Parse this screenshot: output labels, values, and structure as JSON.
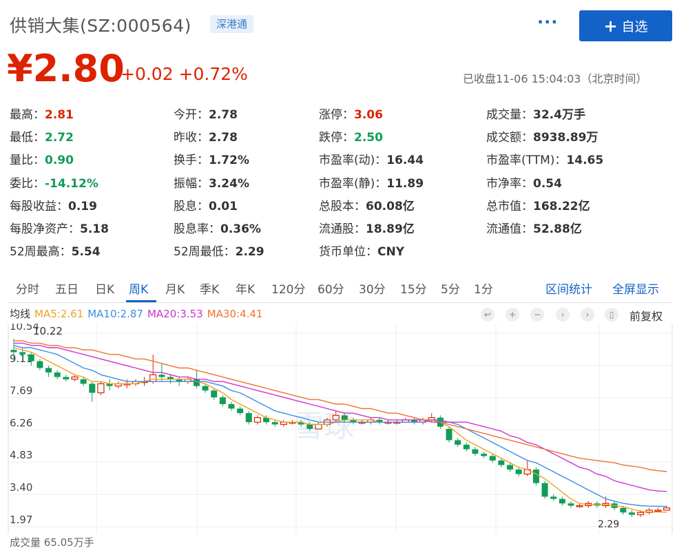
{
  "header": {
    "title": "供销大集(SZ:000564)",
    "badge": "深港通",
    "more": "···",
    "add_label": "自选",
    "add_plus": "+",
    "price": "¥2.80",
    "change": "+0.02 +0.72%",
    "status": "已收盘11-06 15:04:03（北京时间）"
  },
  "colors": {
    "up": "#dd2200",
    "down": "#109d58",
    "accent": "#1262c7"
  },
  "quote": [
    {
      "label": "最高：",
      "value": "2.81",
      "tone": "up"
    },
    {
      "label": "今开：",
      "value": "2.78",
      "tone": ""
    },
    {
      "label": "涨停：",
      "value": "3.06",
      "tone": "up"
    },
    {
      "label": "成交量：",
      "value": "32.4万手",
      "tone": ""
    },
    {
      "label": "最低：",
      "value": "2.72",
      "tone": "dn"
    },
    {
      "label": "昨收：",
      "value": "2.78",
      "tone": ""
    },
    {
      "label": "跌停：",
      "value": "2.50",
      "tone": "dn"
    },
    {
      "label": "成交额：",
      "value": "8938.89万",
      "tone": ""
    },
    {
      "label": "量比：",
      "value": "0.90",
      "tone": "dn"
    },
    {
      "label": "换手：",
      "value": "1.72%",
      "tone": ""
    },
    {
      "label": "市盈率(动)：",
      "value": "16.44",
      "tone": ""
    },
    {
      "label": "市盈率(TTM)：",
      "value": "14.65",
      "tone": ""
    },
    {
      "label": "委比：",
      "value": "-14.12%",
      "tone": "dn"
    },
    {
      "label": "振幅：",
      "value": "3.24%",
      "tone": ""
    },
    {
      "label": "市盈率(静)：",
      "value": "11.89",
      "tone": ""
    },
    {
      "label": "市净率：",
      "value": "0.54",
      "tone": ""
    },
    {
      "label": "每股收益：",
      "value": "0.19",
      "tone": ""
    },
    {
      "label": "股息：",
      "value": "0.01",
      "tone": ""
    },
    {
      "label": "总股本：",
      "value": "60.08亿",
      "tone": ""
    },
    {
      "label": "总市值：",
      "value": "168.22亿",
      "tone": ""
    },
    {
      "label": "每股净资产：",
      "value": "5.18",
      "tone": ""
    },
    {
      "label": "股息率：",
      "value": "0.36%",
      "tone": ""
    },
    {
      "label": "流通股：",
      "value": "18.89亿",
      "tone": ""
    },
    {
      "label": "流通值：",
      "value": "52.88亿",
      "tone": ""
    },
    {
      "label": "52周最高：",
      "value": "5.54",
      "tone": ""
    },
    {
      "label": "52周最低：",
      "value": "2.29",
      "tone": ""
    },
    {
      "label": "货币单位：",
      "value": "CNY",
      "tone": ""
    }
  ],
  "tabs": [
    "分时",
    "五日",
    "日K",
    "周K",
    "月K",
    "季K",
    "年K",
    "120分",
    "60分",
    "30分",
    "15分",
    "5分",
    "1分"
  ],
  "active_tab": 3,
  "tab_tools": [
    "区间统计",
    "全屏显示"
  ],
  "ma": [
    {
      "text": "均线",
      "color": "#333333"
    },
    {
      "text": "MA5:2.61",
      "color": "#f0a020"
    },
    {
      "text": "MA10:2.87",
      "color": "#3a8ee6"
    },
    {
      "text": "MA20:3.53",
      "color": "#cc33cc"
    },
    {
      "text": "MA30:4.41",
      "color": "#f07030"
    }
  ],
  "controls": [
    "↩",
    "+",
    "−",
    "‹",
    "›",
    "▯"
  ],
  "fuquan": "前复权",
  "chart_data": {
    "type": "candlestick",
    "y_ticks": [
      "10.54",
      "9.11",
      "7.69",
      "6.26",
      "4.83",
      "3.40",
      "1.97"
    ],
    "ylim": [
      1.97,
      10.54
    ],
    "high_label": "10.22",
    "low_label": "2.29",
    "volume_label": "成交量 65.05万手",
    "watermark": "雪球",
    "candles": [
      [
        9.8,
        9.7,
        10.3,
        9.3
      ],
      [
        9.7,
        9.6,
        9.9,
        9.3
      ],
      [
        9.6,
        9.3,
        9.7,
        9.1
      ],
      [
        9.3,
        9.0,
        9.4,
        8.9
      ],
      [
        9.0,
        8.8,
        9.1,
        8.6
      ],
      [
        8.8,
        8.6,
        8.9,
        8.5
      ],
      [
        8.6,
        8.5,
        8.7,
        8.4
      ],
      [
        8.5,
        8.6,
        8.7,
        8.4
      ],
      [
        8.5,
        8.3,
        8.6,
        8.2
      ],
      [
        8.3,
        7.9,
        8.4,
        7.5
      ],
      [
        7.9,
        8.3,
        8.4,
        7.8
      ],
      [
        8.3,
        8.2,
        8.5,
        8.0
      ],
      [
        8.2,
        8.3,
        8.4,
        8.1
      ],
      [
        8.3,
        8.3,
        8.5,
        8.1
      ],
      [
        8.3,
        8.4,
        8.5,
        8.2
      ],
      [
        8.4,
        8.4,
        8.6,
        8.2
      ],
      [
        8.4,
        8.7,
        9.6,
        8.3
      ],
      [
        8.7,
        8.6,
        9.2,
        8.4
      ],
      [
        8.6,
        8.5,
        8.7,
        8.3
      ],
      [
        8.5,
        8.4,
        8.6,
        8.2
      ],
      [
        8.4,
        8.5,
        8.6,
        8.3
      ],
      [
        8.5,
        8.2,
        8.9,
        8.1
      ],
      [
        8.2,
        8.0,
        8.3,
        7.9
      ],
      [
        8.0,
        7.7,
        8.1,
        7.6
      ],
      [
        7.7,
        7.4,
        7.8,
        7.3
      ],
      [
        7.4,
        7.2,
        7.5,
        7.1
      ],
      [
        7.2,
        7.0,
        7.3,
        6.9
      ],
      [
        7.0,
        6.6,
        7.1,
        6.5
      ],
      [
        6.6,
        6.8,
        6.9,
        6.5
      ],
      [
        6.8,
        6.6,
        6.9,
        6.5
      ],
      [
        6.6,
        6.5,
        6.7,
        6.4
      ],
      [
        6.5,
        6.6,
        6.7,
        6.4
      ],
      [
        6.6,
        6.6,
        6.7,
        6.5
      ],
      [
        6.6,
        6.5,
        6.7,
        6.4
      ],
      [
        6.5,
        6.3,
        6.6,
        6.2
      ],
      [
        6.3,
        6.5,
        6.6,
        6.3
      ],
      [
        6.5,
        6.7,
        6.8,
        6.4
      ],
      [
        6.7,
        6.9,
        7.1,
        6.6
      ],
      [
        6.9,
        6.7,
        7.0,
        6.6
      ],
      [
        6.7,
        6.6,
        6.8,
        6.5
      ],
      [
        6.6,
        6.6,
        6.7,
        6.5
      ],
      [
        6.6,
        6.7,
        6.8,
        6.5
      ],
      [
        6.7,
        6.6,
        6.8,
        6.5
      ],
      [
        6.6,
        6.6,
        6.7,
        6.5
      ],
      [
        6.6,
        6.6,
        6.7,
        6.5
      ],
      [
        6.6,
        6.7,
        6.8,
        6.6
      ],
      [
        6.7,
        6.6,
        6.8,
        6.5
      ],
      [
        6.6,
        6.7,
        6.8,
        6.5
      ],
      [
        6.7,
        6.8,
        7.0,
        6.6
      ],
      [
        6.8,
        6.4,
        6.9,
        6.3
      ],
      [
        6.3,
        5.8,
        6.4,
        5.7
      ],
      [
        5.8,
        5.6,
        5.9,
        5.5
      ],
      [
        5.6,
        5.4,
        5.7,
        5.3
      ],
      [
        5.4,
        5.2,
        5.5,
        5.1
      ],
      [
        5.2,
        5.1,
        5.3,
        5.0
      ],
      [
        5.1,
        4.9,
        5.2,
        4.8
      ],
      [
        4.9,
        4.7,
        5.0,
        4.6
      ],
      [
        4.7,
        4.5,
        4.8,
        4.4
      ],
      [
        4.5,
        4.3,
        4.6,
        4.2
      ],
      [
        4.3,
        4.5,
        4.9,
        4.2
      ],
      [
        4.5,
        3.9,
        4.6,
        3.8
      ],
      [
        3.9,
        3.3,
        4.0,
        3.2
      ],
      [
        3.3,
        3.2,
        3.4,
        3.1
      ],
      [
        3.2,
        3.0,
        3.3,
        2.9
      ],
      [
        3.0,
        2.9,
        3.1,
        2.8
      ],
      [
        2.9,
        2.9,
        3.0,
        2.8
      ],
      [
        2.9,
        3.0,
        3.1,
        2.8
      ],
      [
        3.0,
        2.9,
        3.1,
        2.8
      ],
      [
        2.9,
        3.0,
        3.3,
        2.8
      ],
      [
        3.0,
        2.8,
        3.1,
        2.7
      ],
      [
        2.8,
        2.6,
        2.9,
        2.5
      ],
      [
        2.6,
        2.5,
        2.7,
        2.4
      ],
      [
        2.5,
        2.6,
        2.7,
        2.4
      ],
      [
        2.6,
        2.7,
        2.8,
        2.5
      ],
      [
        2.7,
        2.7,
        2.8,
        2.6
      ],
      [
        2.7,
        2.8,
        2.9,
        2.7
      ]
    ],
    "series": [
      {
        "name": "MA5",
        "color": "#f0a020",
        "values": [
          9.9,
          9.8,
          9.7,
          9.5,
          9.3,
          9.1,
          8.9,
          8.7,
          8.6,
          8.4,
          8.4,
          8.3,
          8.3,
          8.3,
          8.3,
          8.4,
          8.5,
          8.5,
          8.5,
          8.5,
          8.5,
          8.4,
          8.3,
          8.1,
          7.9,
          7.6,
          7.4,
          7.2,
          7.0,
          6.8,
          6.7,
          6.6,
          6.6,
          6.6,
          6.5,
          6.5,
          6.5,
          6.6,
          6.7,
          6.7,
          6.7,
          6.7,
          6.6,
          6.6,
          6.6,
          6.6,
          6.6,
          6.6,
          6.7,
          6.6,
          6.4,
          6.1,
          5.8,
          5.6,
          5.4,
          5.2,
          5.0,
          4.8,
          4.6,
          4.5,
          4.3,
          4.1,
          3.8,
          3.5,
          3.2,
          3.0,
          2.95,
          2.95,
          2.95,
          2.9,
          2.85,
          2.75,
          2.65,
          2.62,
          2.62,
          2.61
        ]
      },
      {
        "name": "MA10",
        "color": "#3a8ee6",
        "values": [
          10.0,
          9.9,
          9.9,
          9.8,
          9.7,
          9.6,
          9.4,
          9.2,
          9.0,
          8.9,
          8.7,
          8.6,
          8.5,
          8.4,
          8.4,
          8.4,
          8.4,
          8.4,
          8.4,
          8.4,
          8.4,
          8.4,
          8.4,
          8.3,
          8.2,
          8.0,
          7.9,
          7.7,
          7.5,
          7.3,
          7.1,
          7.0,
          6.9,
          6.8,
          6.7,
          6.6,
          6.6,
          6.6,
          6.6,
          6.6,
          6.6,
          6.6,
          6.6,
          6.6,
          6.6,
          6.6,
          6.6,
          6.6,
          6.7,
          6.7,
          6.6,
          6.5,
          6.3,
          6.1,
          5.9,
          5.7,
          5.5,
          5.3,
          5.1,
          4.9,
          4.8,
          4.6,
          4.4,
          4.2,
          4.0,
          3.8,
          3.6,
          3.4,
          3.2,
          3.1,
          3.0,
          2.95,
          2.9,
          2.88,
          2.87,
          2.87
        ]
      },
      {
        "name": "MA20",
        "color": "#cc33cc",
        "values": [
          10.1,
          10.1,
          10.0,
          10.0,
          9.9,
          9.9,
          9.8,
          9.7,
          9.6,
          9.5,
          9.4,
          9.3,
          9.2,
          9.1,
          9.0,
          8.9,
          8.8,
          8.8,
          8.7,
          8.6,
          8.6,
          8.5,
          8.5,
          8.4,
          8.4,
          8.3,
          8.2,
          8.1,
          8.0,
          7.9,
          7.8,
          7.7,
          7.6,
          7.5,
          7.4,
          7.3,
          7.2,
          7.1,
          7.0,
          7.0,
          6.9,
          6.8,
          6.8,
          6.7,
          6.7,
          6.7,
          6.7,
          6.7,
          6.6,
          6.6,
          6.6,
          6.6,
          6.6,
          6.5,
          6.4,
          6.3,
          6.2,
          6.0,
          5.9,
          5.7,
          5.6,
          5.4,
          5.2,
          5.0,
          4.8,
          4.6,
          4.5,
          4.3,
          4.2,
          4.0,
          3.9,
          3.8,
          3.7,
          3.6,
          3.55,
          3.53
        ]
      },
      {
        "name": "MA30",
        "color": "#f07030",
        "values": [
          10.2,
          10.2,
          10.1,
          10.1,
          10.0,
          10.0,
          9.9,
          9.9,
          9.8,
          9.8,
          9.7,
          9.6,
          9.6,
          9.5,
          9.4,
          9.4,
          9.3,
          9.2,
          9.1,
          9.0,
          9.0,
          8.9,
          8.8,
          8.7,
          8.6,
          8.5,
          8.4,
          8.3,
          8.2,
          8.1,
          8.0,
          7.9,
          7.8,
          7.7,
          7.6,
          7.6,
          7.5,
          7.4,
          7.4,
          7.3,
          7.2,
          7.2,
          7.1,
          7.0,
          7.0,
          6.9,
          6.8,
          6.7,
          6.7,
          6.6,
          6.5,
          6.4,
          6.3,
          6.2,
          6.1,
          6.0,
          5.9,
          5.8,
          5.7,
          5.6,
          5.5,
          5.4,
          5.3,
          5.2,
          5.1,
          5.0,
          4.95,
          4.9,
          4.85,
          4.8,
          4.7,
          4.65,
          4.6,
          4.5,
          4.45,
          4.41
        ]
      }
    ]
  }
}
